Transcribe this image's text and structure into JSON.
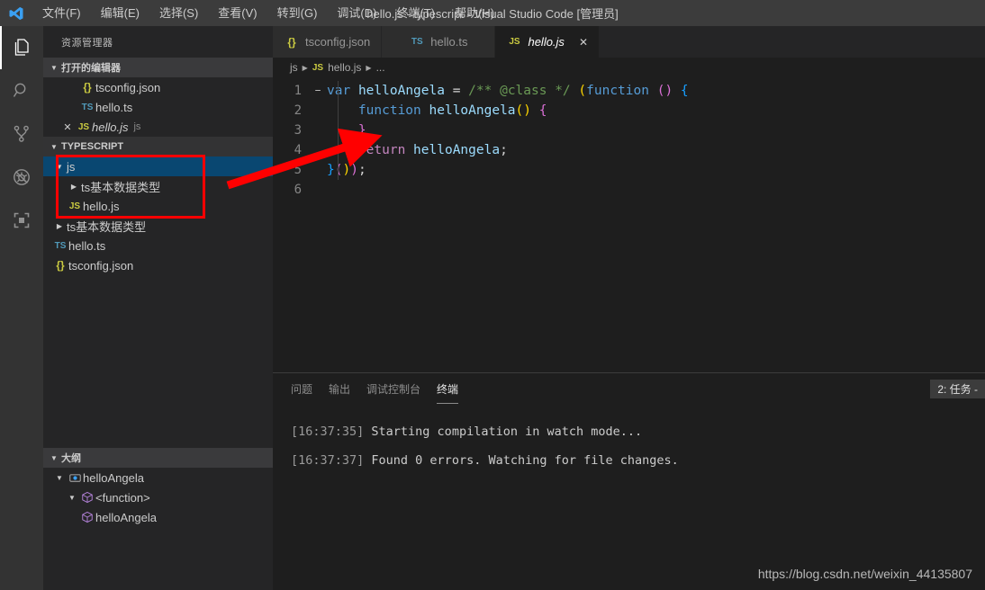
{
  "window": {
    "title": "hello.js - typescript - Visual Studio Code [管理员]",
    "logo_icon": "vscode-logo-icon"
  },
  "menubar": {
    "items": [
      {
        "label": "文件(F)",
        "key": "F"
      },
      {
        "label": "编辑(E)",
        "key": "E"
      },
      {
        "label": "选择(S)",
        "key": "S"
      },
      {
        "label": "查看(V)",
        "key": "V"
      },
      {
        "label": "转到(G)",
        "key": "G"
      },
      {
        "label": "调试(D)",
        "key": "D"
      },
      {
        "label": "终端(T)",
        "key": "T"
      },
      {
        "label": "帮助(H)",
        "key": "H"
      }
    ]
  },
  "activitybar": {
    "items": [
      {
        "name": "explorer-icon",
        "active": true
      },
      {
        "name": "search-icon",
        "active": false
      },
      {
        "name": "source-control-icon",
        "active": false
      },
      {
        "name": "debug-icon",
        "active": false
      },
      {
        "name": "extensions-icon",
        "active": false
      }
    ]
  },
  "sidebar": {
    "title": "资源管理器",
    "open_editors": {
      "header": "打开的编辑器",
      "items": [
        {
          "label": "tsconfig.json",
          "icon": "json-icon",
          "dirty": false,
          "active": false,
          "path": ""
        },
        {
          "label": "hello.ts",
          "icon": "ts-icon",
          "dirty": false,
          "active": false,
          "path": ""
        },
        {
          "label": "hello.js",
          "icon": "js-icon",
          "dirty": false,
          "active": true,
          "path": "js"
        }
      ]
    },
    "folder": {
      "header": "TYPESCRIPT",
      "items": [
        {
          "label": "js",
          "type": "folder",
          "expanded": true,
          "depth": 0,
          "selected": true,
          "icon": ""
        },
        {
          "label": "ts基本数据类型",
          "type": "folder",
          "expanded": false,
          "depth": 1,
          "selected": false,
          "icon": ""
        },
        {
          "label": "hello.js",
          "type": "file",
          "expanded": false,
          "depth": 1,
          "selected": false,
          "icon": "js-icon"
        },
        {
          "label": "ts基本数据类型",
          "type": "folder",
          "expanded": false,
          "depth": 0,
          "selected": false,
          "icon": ""
        },
        {
          "label": "hello.ts",
          "type": "file",
          "expanded": false,
          "depth": 0,
          "selected": false,
          "icon": "ts-icon"
        },
        {
          "label": "tsconfig.json",
          "type": "file",
          "expanded": false,
          "depth": 0,
          "selected": false,
          "icon": "json-icon"
        }
      ]
    },
    "outline": {
      "header": "大纲",
      "items": [
        {
          "label": "helloAngela",
          "icon": "variable-icon",
          "depth": 0,
          "expanded": true
        },
        {
          "label": "<function>",
          "icon": "module-icon",
          "depth": 1,
          "expanded": true
        },
        {
          "label": "helloAngela",
          "icon": "module-icon",
          "depth": 2,
          "expanded": false
        }
      ]
    }
  },
  "editor": {
    "tabs": [
      {
        "label": "tsconfig.json",
        "icon": "json-icon",
        "active": false,
        "closable": false
      },
      {
        "label": "hello.ts",
        "icon": "ts-icon",
        "active": false,
        "closable": false
      },
      {
        "label": "hello.js",
        "icon": "js-icon",
        "active": true,
        "closable": true
      }
    ],
    "close_glyph": "✕",
    "breadcrumb": [
      "js",
      "hello.js",
      "..."
    ],
    "breadcrumb_icon": "js-icon",
    "lines": [
      {
        "num": "1",
        "fold": "−"
      },
      {
        "num": "2",
        "fold": ""
      },
      {
        "num": "3",
        "fold": ""
      },
      {
        "num": "4",
        "fold": ""
      },
      {
        "num": "5",
        "fold": ""
      },
      {
        "num": "6",
        "fold": ""
      }
    ],
    "code_text": [
      "var helloAngela = /** @class */ (function () {",
      "    function helloAngela() {",
      "    }",
      "    return helloAngela;",
      "}());",
      ""
    ]
  },
  "panel": {
    "tabs": [
      {
        "label": "问题",
        "active": false
      },
      {
        "label": "输出",
        "active": false
      },
      {
        "label": "调试控制台",
        "active": false
      },
      {
        "label": "终端",
        "active": true
      }
    ],
    "terminal_selector": "2: 任务 -",
    "terminal_lines": [
      {
        "time": "[16:37:35]",
        "text": " Starting compilation in watch mode..."
      },
      {
        "time": "[16:37:37]",
        "text": " Found 0 errors. Watching for file changes."
      }
    ]
  },
  "annotations": {
    "highlight_color": "#ff0000",
    "arrow_icon": "red-arrow-icon",
    "box_icon": "red-rectangle-icon"
  },
  "watermark": {
    "text": "https://blog.csdn.net/weixin_44135807"
  }
}
